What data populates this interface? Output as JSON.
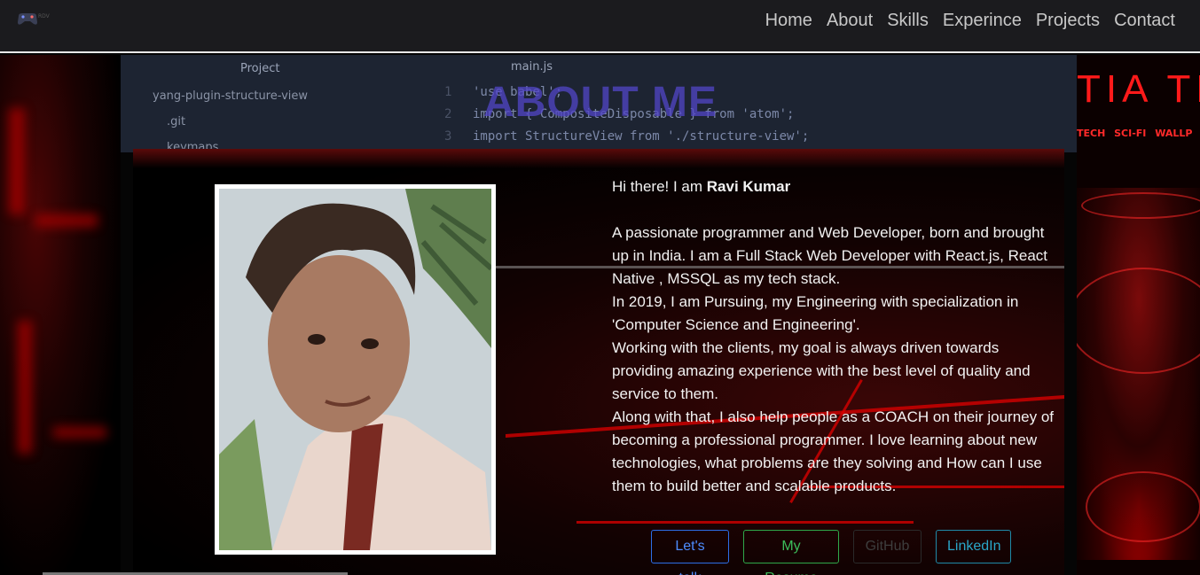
{
  "nav": {
    "logo_text": "RDV",
    "links": [
      "Home",
      "About",
      "Skills",
      "Experince",
      "Projects",
      "Contact"
    ]
  },
  "editor_bg": {
    "project_label": "Project",
    "tree": [
      "yang-plugin-structure-view",
      ".git",
      "keymaps"
    ],
    "tab": "main.js",
    "code": [
      {
        "n": "1",
        "t": "'use babel';"
      },
      {
        "n": "2",
        "t": "import { CompositeDisposable } from 'atom';"
      },
      {
        "n": "3",
        "t": "import StructureView from './structure-view';"
      }
    ]
  },
  "section": {
    "title": "ABOUT ME"
  },
  "wallpaper_right": {
    "sign": "TIA TE",
    "tags": "TECH SCI-FI WALLP"
  },
  "bio": {
    "greet_prefix": "Hi there! I am ",
    "name": "Ravi Kumar",
    "p1": "A passionate programmer and Web Developer, born and brought up in India. I am a Full Stack Web Developer with React.js, React Native , MSSQL as my tech stack.",
    "p2": "In 2019, I am Pursuing, my Engineering with specialization in 'Computer Science and Engineering'.",
    "p3": "Working with the clients, my goal is always driven towards providing amazing experience with the best level of quality and service to them.",
    "p4": "Along with that, I also help people as a COACH on their journey of becoming a professional programmer. I love learning about new technologies, what problems are they solving and How can I use them to build better and scalable products."
  },
  "buttons": {
    "talk": "Let's talk",
    "resume": "My Resume",
    "github": "GitHub",
    "linkedin": "LinkedIn"
  },
  "colors": {
    "accent_blue": "#2d6ee8",
    "accent_green": "#2fa84a",
    "accent_cyan": "#1f8aa8",
    "neon_red": "#e00000"
  }
}
